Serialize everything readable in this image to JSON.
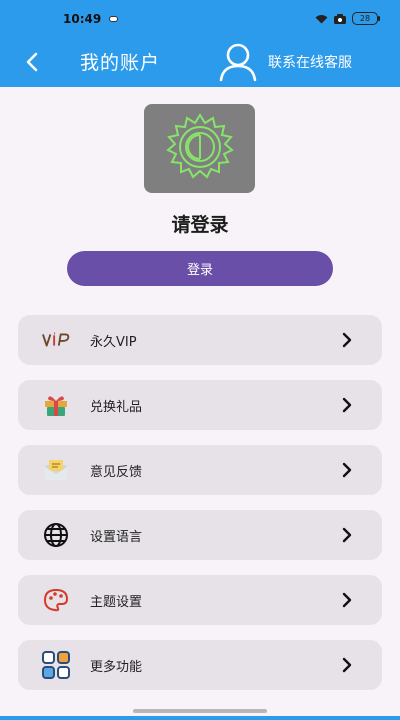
{
  "status": {
    "time": "10:49",
    "battery": "28"
  },
  "header": {
    "title": "我的账户",
    "customer_service": "联系在线客服"
  },
  "profile": {
    "prompt": "请登录",
    "login_button": "登录"
  },
  "menu": [
    {
      "label": "永久VIP",
      "icon": "vip-icon"
    },
    {
      "label": "兑换礼品",
      "icon": "gift-icon"
    },
    {
      "label": "意见反馈",
      "icon": "feedback-mail-icon"
    },
    {
      "label": "设置语言",
      "icon": "globe-icon"
    },
    {
      "label": "主题设置",
      "icon": "palette-icon"
    },
    {
      "label": "更多功能",
      "icon": "apps-grid-icon"
    }
  ],
  "colors": {
    "appbar": "#2c9bec",
    "button": "#6a4fa8",
    "card": "#e7e1e8",
    "background": "#f8f3f8"
  }
}
